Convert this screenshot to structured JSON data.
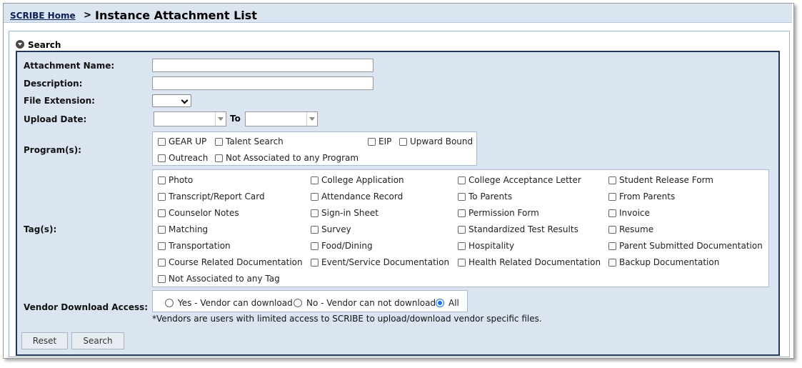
{
  "header": {
    "breadcrumb_home": "SCRIBE Home",
    "separator": ">",
    "title": "Instance Attachment List"
  },
  "search": {
    "section_label": "Search",
    "attachment_name": {
      "label": "Attachment Name:",
      "value": ""
    },
    "description": {
      "label": "Description:",
      "value": ""
    },
    "file_extension": {
      "label": "File Extension:",
      "selected": ""
    },
    "upload_date": {
      "label": "Upload Date:",
      "from": "",
      "to_label": "To",
      "to": ""
    },
    "programs": {
      "label": "Program(s):",
      "items": [
        {
          "label": "GEAR UP",
          "checked": false
        },
        {
          "label": "Talent Search",
          "checked": false
        },
        {
          "label": "EIP",
          "checked": false
        },
        {
          "label": "Upward Bound",
          "checked": false
        },
        {
          "label": "Outreach",
          "checked": false
        },
        {
          "label": "Not Associated to any Program",
          "checked": false
        }
      ]
    },
    "tags": {
      "label": "Tag(s):",
      "items": [
        {
          "label": "Photo",
          "checked": false
        },
        {
          "label": "College Application",
          "checked": false
        },
        {
          "label": "College Acceptance Letter",
          "checked": false
        },
        {
          "label": "Student Release Form",
          "checked": false
        },
        {
          "label": "Transcript/Report Card",
          "checked": false
        },
        {
          "label": "Attendance Record",
          "checked": false
        },
        {
          "label": "To Parents",
          "checked": false
        },
        {
          "label": "From Parents",
          "checked": false
        },
        {
          "label": "Counselor Notes",
          "checked": false
        },
        {
          "label": "Sign-in Sheet",
          "checked": false
        },
        {
          "label": "Permission Form",
          "checked": false
        },
        {
          "label": "Invoice",
          "checked": false
        },
        {
          "label": "Matching",
          "checked": false
        },
        {
          "label": "Survey",
          "checked": false
        },
        {
          "label": "Standardized Test Results",
          "checked": false
        },
        {
          "label": "Resume",
          "checked": false
        },
        {
          "label": "Transportation",
          "checked": false
        },
        {
          "label": "Food/Dining",
          "checked": false
        },
        {
          "label": "Hospitality",
          "checked": false
        },
        {
          "label": "Parent Submitted Documentation",
          "checked": false
        },
        {
          "label": "Course Related Documentation",
          "checked": false
        },
        {
          "label": "Event/Service Documentation",
          "checked": false
        },
        {
          "label": "Health Related Documentation",
          "checked": false
        },
        {
          "label": "Backup Documentation",
          "checked": false
        },
        {
          "label": "Not Associated to any Tag",
          "checked": false
        }
      ]
    },
    "vendor_access": {
      "label": "Vendor Download Access:",
      "options": [
        {
          "label": "Yes - Vendor can download",
          "selected": false
        },
        {
          "label": "No - Vendor can not download",
          "selected": false
        },
        {
          "label": "All",
          "selected": true
        }
      ],
      "note": "*Vendors are users with limited access to SCRIBE to upload/download vendor specific files."
    },
    "buttons": {
      "reset": "Reset",
      "search": "Search"
    }
  },
  "colors": {
    "panel_bg": "#dbe5f1",
    "panel_border": "#22385e",
    "radio_selected": "#1a73e8"
  }
}
